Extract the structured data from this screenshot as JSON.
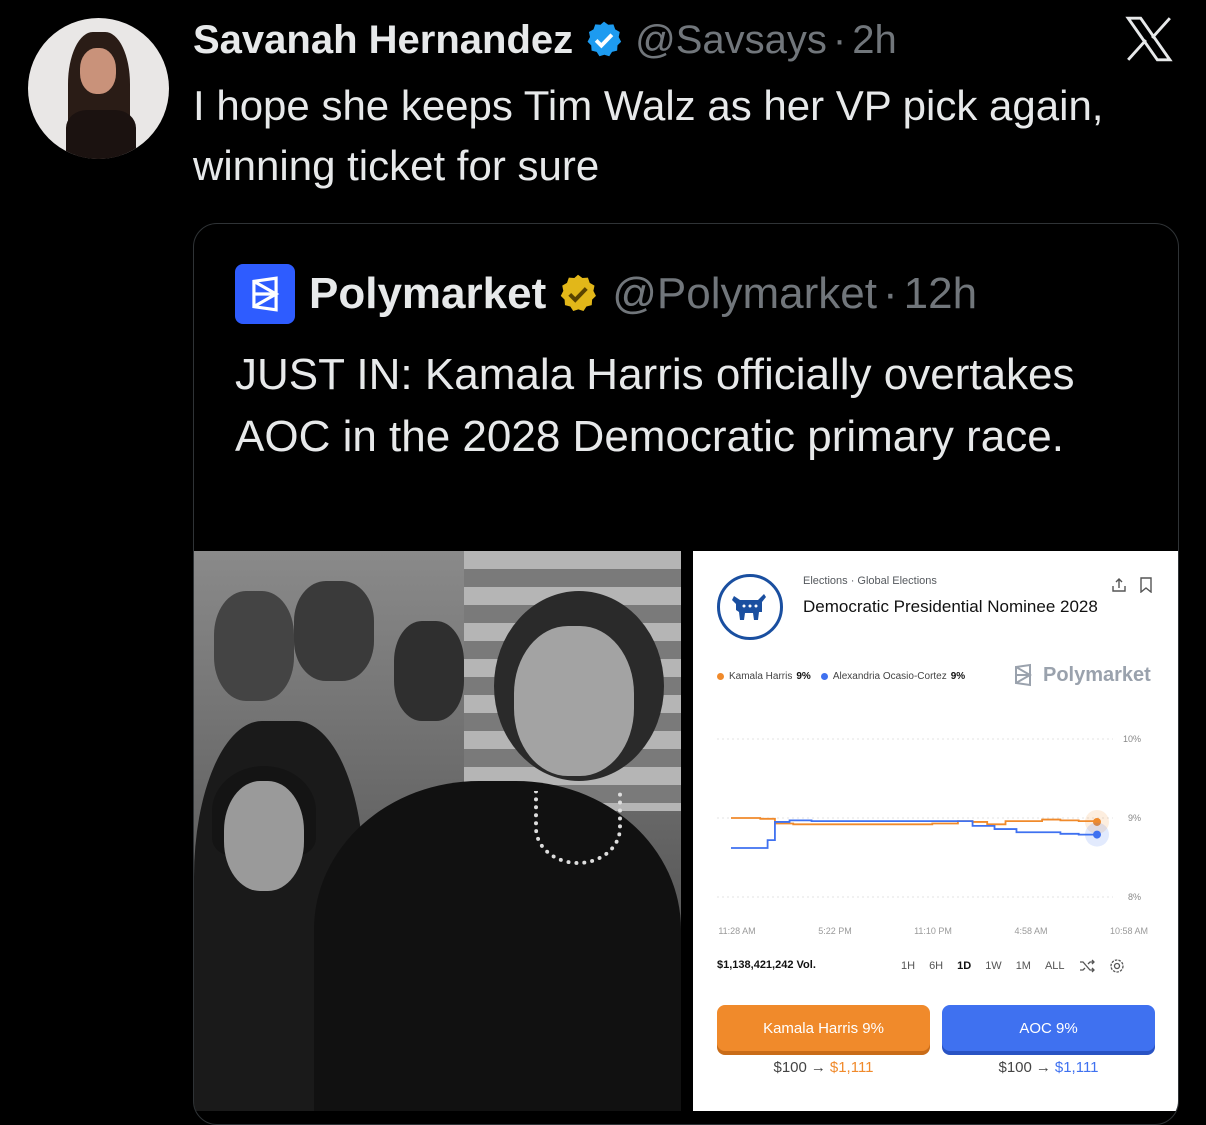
{
  "tweet": {
    "author": "Savanah Hernandez",
    "handle": "@Savsays",
    "time": "2h",
    "separator": "·",
    "text": "I hope she keeps Tim Walz as her VP pick again, winning ticket for sure"
  },
  "quoted_tweet": {
    "author": "Polymarket",
    "handle": "@Polymarket",
    "time": "12h",
    "separator": "·",
    "text": "JUST IN: Kamala Harris officially overtakes AOC in the 2028 Democratic primary race."
  },
  "market_card": {
    "breadcrumb": "Elections · Global Elections",
    "title": "Democratic Presidential Nominee 2028",
    "legend": [
      {
        "name": "Kamala Harris",
        "value": "9%",
        "color": "#f08a2b"
      },
      {
        "name": "Alexandria Ocasio-Cortez",
        "value": "9%",
        "color": "#3f71f0"
      }
    ],
    "watermark": "Polymarket",
    "volume": "$1,138,421,242 Vol.",
    "ranges": [
      "1H",
      "6H",
      "1D",
      "1W",
      "1M",
      "ALL"
    ],
    "active_range": "1D",
    "buttons": [
      {
        "label": "Kamala Harris 9%",
        "payout_from": "$100",
        "payout_to": "$1,111"
      },
      {
        "label": "AOC 9%",
        "payout_from": "$100",
        "payout_to": "$1,111"
      }
    ]
  },
  "chart_data": {
    "type": "line",
    "x": [
      "11:28 AM",
      "5:22 PM",
      "11:10 PM",
      "4:58 AM",
      "10:58 AM"
    ],
    "y_ticks": [
      "10%",
      "9%",
      "8%"
    ],
    "ylim": [
      8,
      10
    ],
    "series": [
      {
        "name": "Kamala Harris",
        "color": "#f08a2b",
        "points": [
          [
            0,
            9.0
          ],
          [
            0.05,
            9.0
          ],
          [
            0.08,
            8.99
          ],
          [
            0.12,
            8.93
          ],
          [
            0.17,
            8.92
          ],
          [
            0.25,
            8.92
          ],
          [
            0.35,
            8.92
          ],
          [
            0.45,
            8.92
          ],
          [
            0.5,
            8.92
          ],
          [
            0.55,
            8.93
          ],
          [
            0.62,
            8.96
          ],
          [
            0.66,
            8.95
          ],
          [
            0.7,
            8.92
          ],
          [
            0.75,
            8.96
          ],
          [
            0.8,
            8.96
          ],
          [
            0.85,
            8.98
          ],
          [
            0.9,
            8.97
          ],
          [
            0.95,
            8.96
          ],
          [
            1.0,
            8.95
          ]
        ]
      },
      {
        "name": "Alexandria Ocasio-Cortez",
        "color": "#3f71f0",
        "points": [
          [
            0,
            8.62
          ],
          [
            0.08,
            8.62
          ],
          [
            0.1,
            8.72
          ],
          [
            0.12,
            8.95
          ],
          [
            0.16,
            8.97
          ],
          [
            0.22,
            8.96
          ],
          [
            0.35,
            8.96
          ],
          [
            0.5,
            8.96
          ],
          [
            0.58,
            8.96
          ],
          [
            0.62,
            8.96
          ],
          [
            0.66,
            8.9
          ],
          [
            0.72,
            8.86
          ],
          [
            0.78,
            8.82
          ],
          [
            0.84,
            8.82
          ],
          [
            0.9,
            8.8
          ],
          [
            0.95,
            8.79
          ],
          [
            1.0,
            8.79
          ]
        ]
      }
    ]
  }
}
